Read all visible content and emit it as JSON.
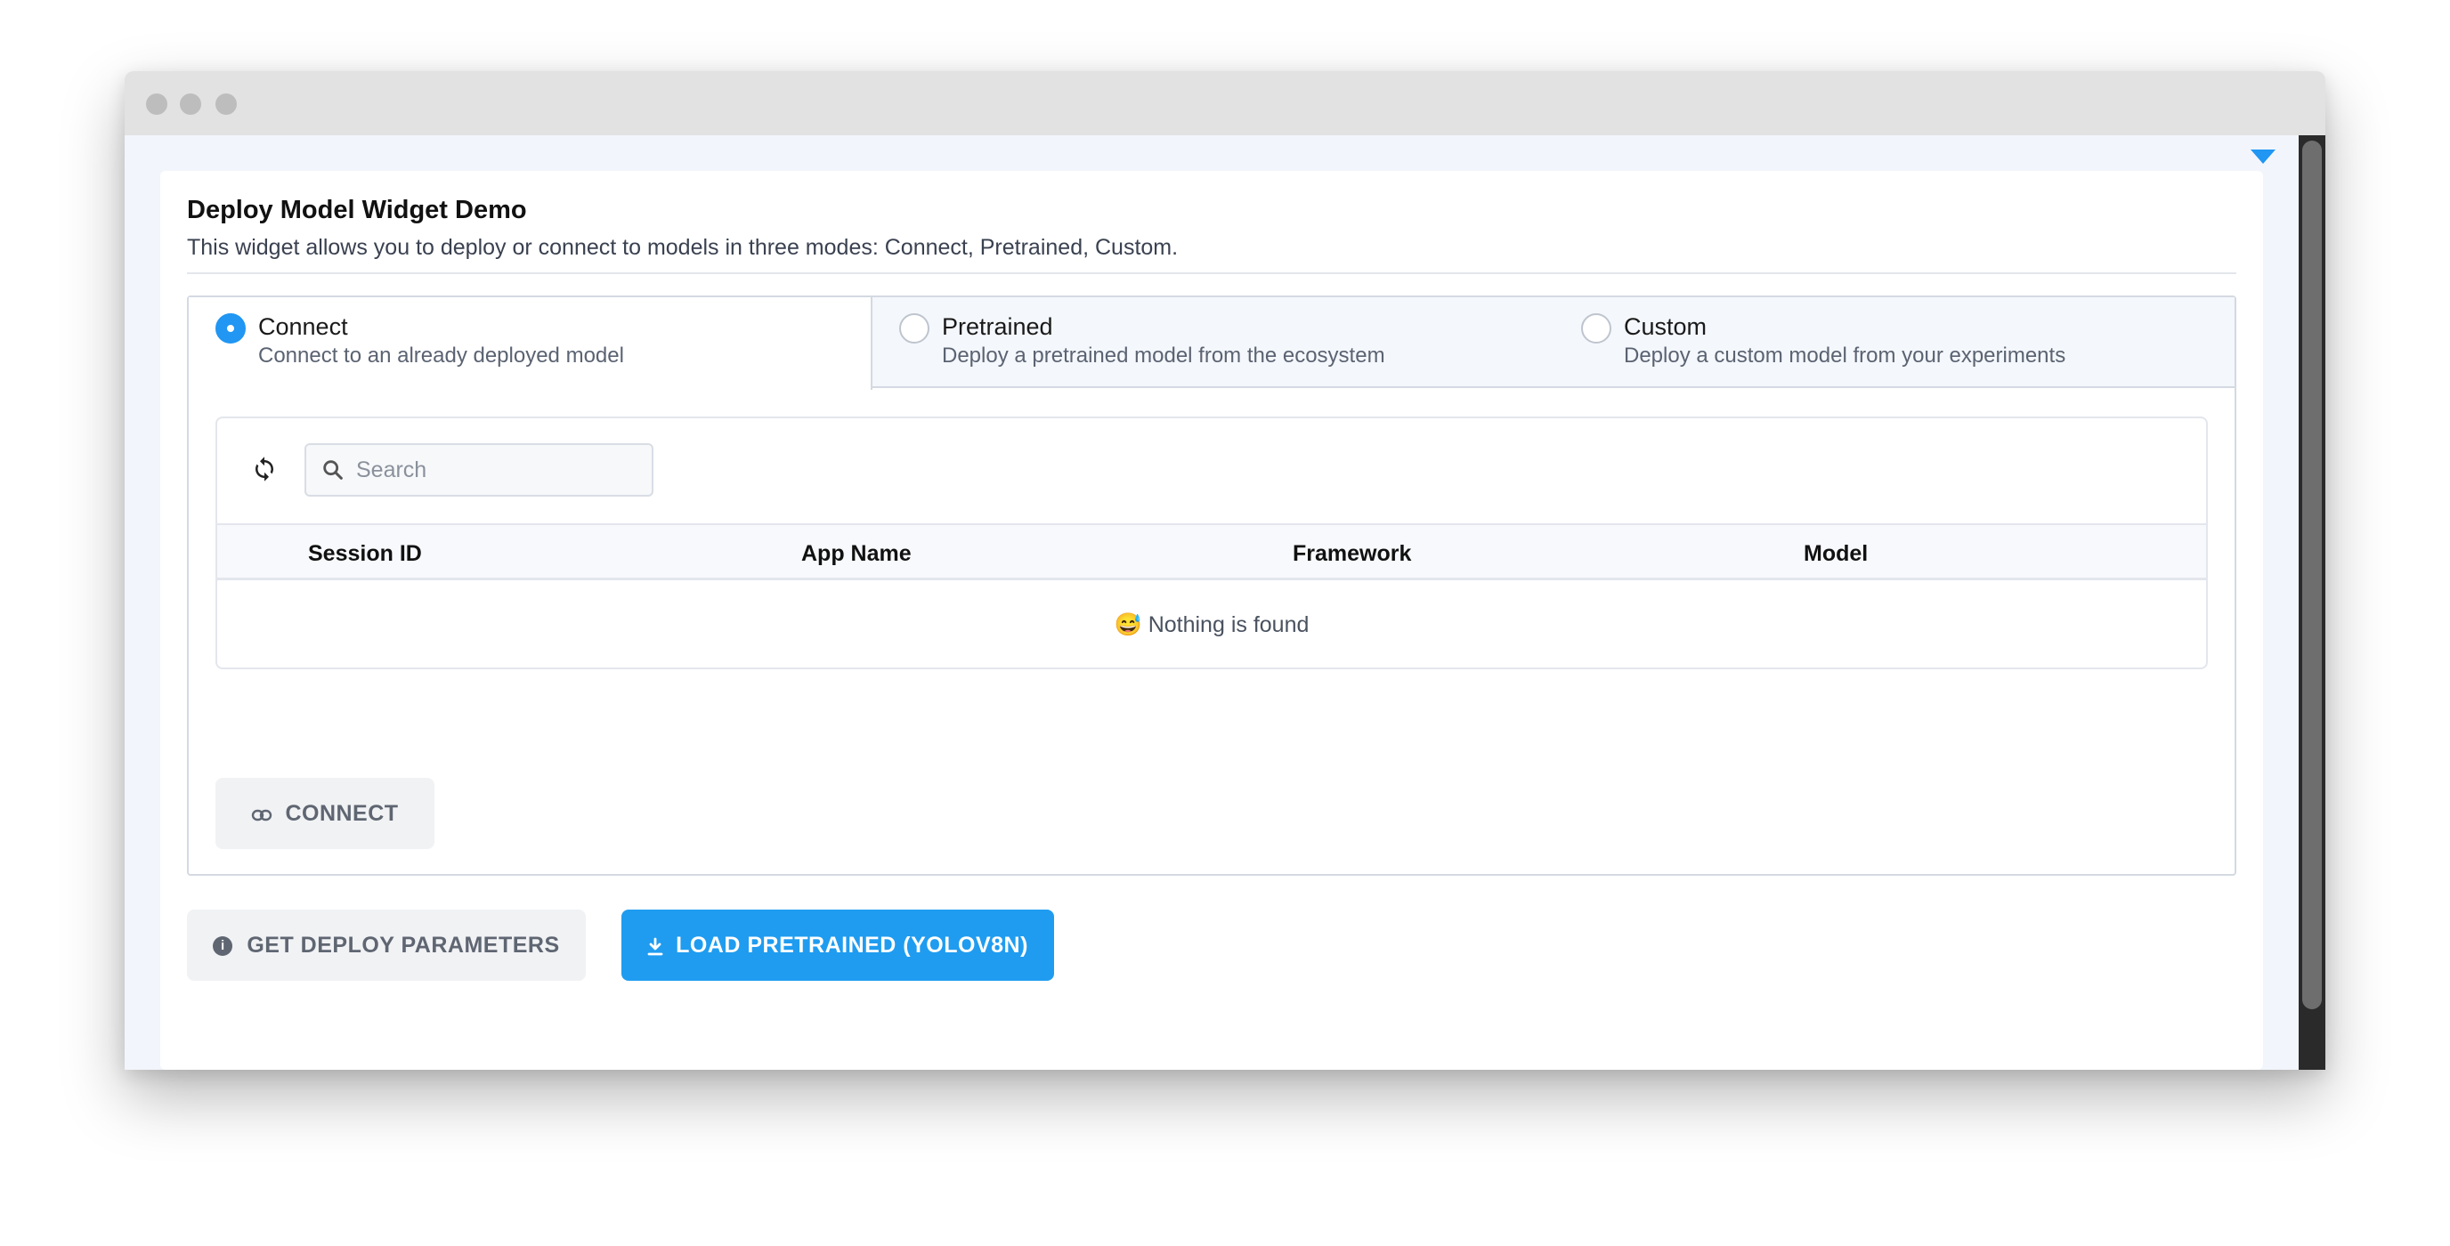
{
  "card": {
    "title": "Deploy Model Widget Demo",
    "description": "This widget allows you to deploy or connect to models in three modes: Connect, Pretrained, Custom."
  },
  "tabs": [
    {
      "label": "Connect",
      "sub": "Connect to an already deployed model",
      "selected": true
    },
    {
      "label": "Pretrained",
      "sub": "Deploy a pretrained model from the ecosystem",
      "selected": false
    },
    {
      "label": "Custom",
      "sub": "Deploy a custom model from your experiments",
      "selected": false
    }
  ],
  "search": {
    "placeholder": "Search",
    "value": ""
  },
  "table": {
    "columns": [
      "Session ID",
      "App Name",
      "Framework",
      "Model"
    ],
    "rows": [],
    "empty_message": "😅 Nothing is found"
  },
  "buttons": {
    "connect": "CONNECT",
    "get_deploy_parameters": "GET DEPLOY PARAMETERS",
    "load_pretrained": "LOAD PRETRAINED (YOLOV8N)"
  },
  "icons": {
    "refresh": "refresh-icon",
    "search": "search-icon",
    "link": "link-icon",
    "info": "info-icon",
    "download": "download-icon",
    "collapse": "caret-down-icon"
  },
  "colors": {
    "accent": "#2196f3",
    "primary_button": "#1f9cf0",
    "secondary_button": "#f1f2f4",
    "page_background": "#f2f5fc"
  }
}
